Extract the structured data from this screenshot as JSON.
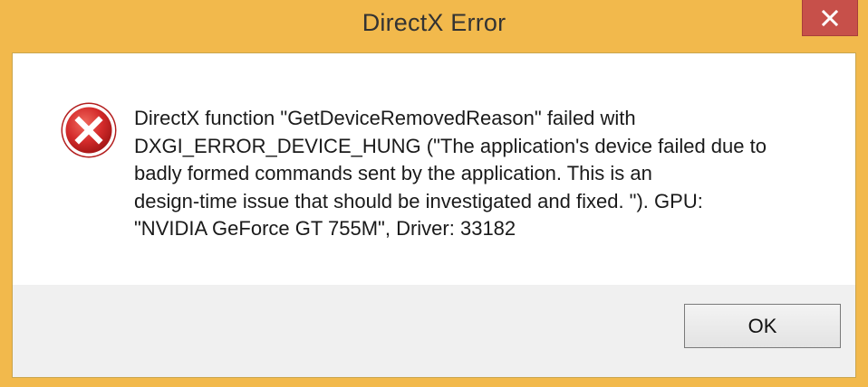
{
  "window": {
    "title": "DirectX Error",
    "close_icon": "close-icon"
  },
  "dialog": {
    "icon": "error-icon",
    "message_lines": [
      "DirectX function \"GetDeviceRemovedReason\" failed with",
      "DXGI_ERROR_DEVICE_HUNG (\"The application's device failed due to",
      "badly formed commands sent by the application. This is an",
      "design-time issue that should be investigated and fixed. \"). GPU:",
      "\"NVIDIA GeForce GT 755M\", Driver: 33182"
    ],
    "ok_label": "OK"
  },
  "colors": {
    "frame": "#f2b94c",
    "close_button": "#c7504a",
    "error_red": "#d42b2b"
  }
}
